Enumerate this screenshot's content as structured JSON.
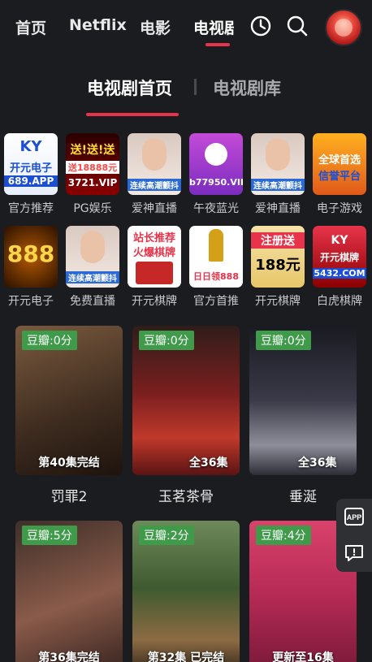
{
  "nav": {
    "tabs": [
      "首页",
      "Netflix",
      "电影",
      "电视剧"
    ],
    "icons": [
      "history-icon",
      "search-icon"
    ]
  },
  "subtabs": [
    "电视剧首页",
    "电视剧库"
  ],
  "ads_row1": [
    {
      "label": "官方推荐",
      "text": "开元电子",
      "sub": "689.APP"
    },
    {
      "label": "PG娱乐",
      "text": "送!送!送",
      "sub": "3721.VIP"
    },
    {
      "label": "爱神直播",
      "text": "连续高潮颤抖"
    },
    {
      "label": "午夜蓝光",
      "text": "b77950.VIP"
    },
    {
      "label": "爱神直播",
      "text": "连续高潮颤抖"
    },
    {
      "label": "电子游戏",
      "text": "全球首选",
      "sub": "信誉平台"
    }
  ],
  "ads_row2": [
    {
      "label": "开元电子",
      "text": "888"
    },
    {
      "label": "免费直播",
      "text": "连续高潮颤抖"
    },
    {
      "label": "开元棋牌",
      "text": "站长推荐",
      "sub": "火爆棋牌"
    },
    {
      "label": "官方首推",
      "text": "日日领888"
    },
    {
      "label": "开元棋牌",
      "text": "注册送",
      "sub": "188元"
    },
    {
      "label": "白虎棋牌",
      "text": "开元棋牌",
      "sub": "5432.COM"
    }
  ],
  "cards": [
    {
      "score": "豆瓣:0分",
      "status": "第40集完结",
      "title": "罚罪2"
    },
    {
      "score": "豆瓣:0分",
      "status": "全36集",
      "title": "玉茗茶骨"
    },
    {
      "score": "豆瓣:0分",
      "status": "全36集",
      "title": "垂涎"
    },
    {
      "score": "豆瓣:5分",
      "status": "第36集完结",
      "title": ""
    },
    {
      "score": "豆瓣:2分",
      "status": "第32集 已完结",
      "title": ""
    },
    {
      "score": "豆瓣:4分",
      "status": "更新至16集",
      "title": ""
    }
  ],
  "side": {
    "app": "APP"
  },
  "colors": {
    "accent": "#e8344b",
    "score_bg": "#3f9a4a",
    "background": "#1b1c1f"
  }
}
